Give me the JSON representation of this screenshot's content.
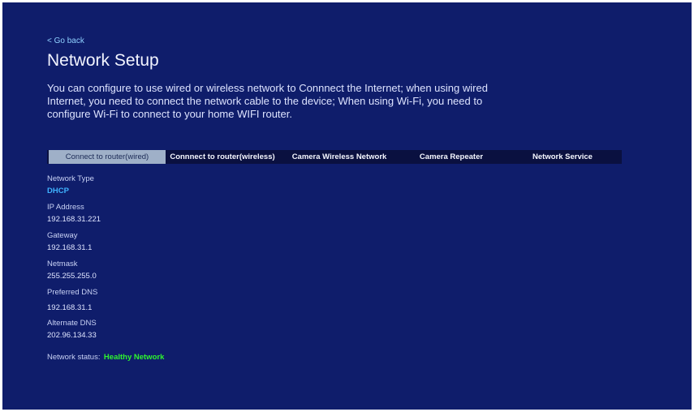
{
  "nav": {
    "back_label": "< Go back"
  },
  "header": {
    "title": "Network Setup",
    "description": "You can configure to use wired or wireless network to Connnect the Internet; when using wired Internet, you need to connect the network cable to the device; When using Wi-Fi, you need to configure Wi-Fi to connect to your home WIFI router."
  },
  "tabs": [
    {
      "label": "Connect to router(wired)",
      "active": true
    },
    {
      "label": "Connnect to router(wireless)",
      "active": false
    },
    {
      "label": "Camera Wireless Network",
      "active": false
    },
    {
      "label": "Camera Repeater",
      "active": false
    },
    {
      "label": "Network Service",
      "active": false
    }
  ],
  "details": {
    "network_type": {
      "label": "Network Type",
      "value": "DHCP"
    },
    "ip_address": {
      "label": "IP Address",
      "value": "192.168.31.221"
    },
    "gateway": {
      "label": "Gateway",
      "value": "192.168.31.1"
    },
    "netmask": {
      "label": "Netmask",
      "value": "255.255.255.0"
    },
    "preferred_dns": {
      "label": "Preferred DNS",
      "value": "192.168.31.1"
    },
    "alternate_dns": {
      "label": "Alternate DNS",
      "value": "202.96.134.33"
    },
    "network_status": {
      "label": "Network status:",
      "value": "Healthy Network"
    }
  },
  "colors": {
    "background": "#0f1d6b",
    "link": "#8fd0ff",
    "dhcp": "#3fb2ff",
    "status_ok": "#2ef52e",
    "active_tab": "#9fb0c8"
  }
}
